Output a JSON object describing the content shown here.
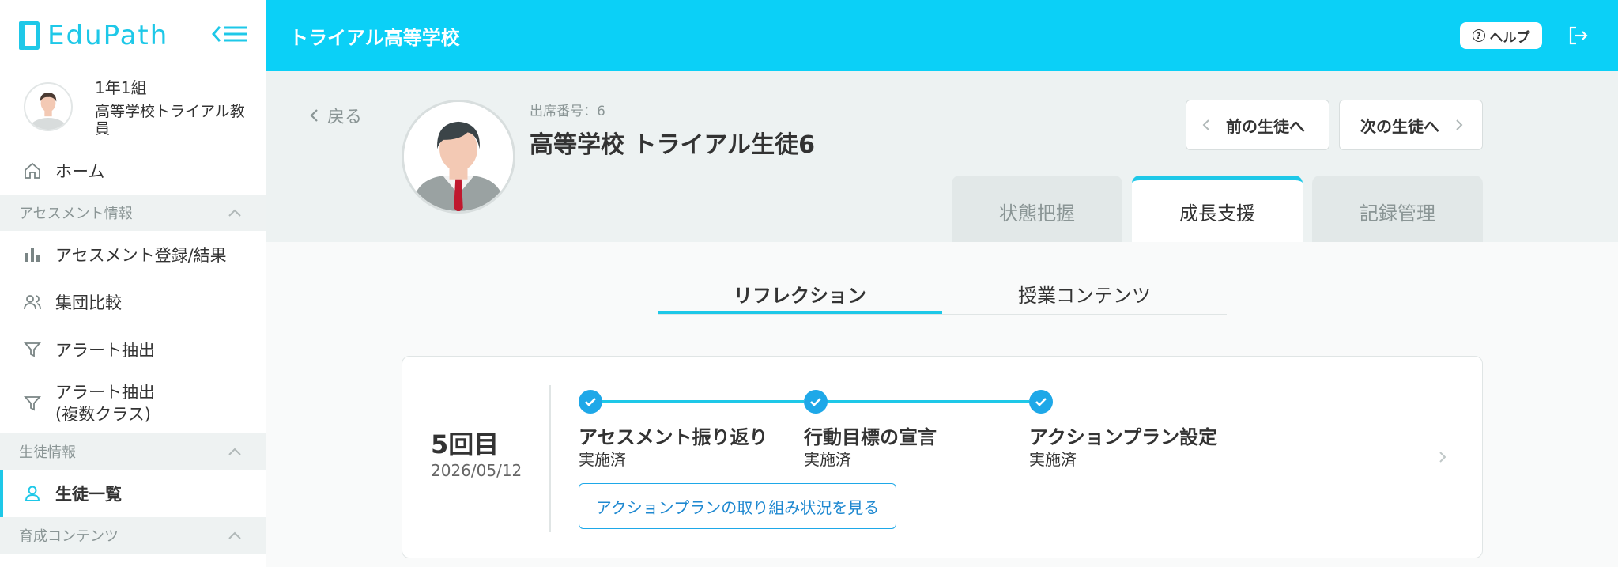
{
  "app": {
    "logo_text": "EduPath",
    "brand_color": "#1ec8e8",
    "header_color": "#0bd0f7"
  },
  "header": {
    "school_title": "トライアル高等学校",
    "help_label": "ヘルプ"
  },
  "user": {
    "class_name": "1年1組",
    "user_name": "高等学校トライアル教員"
  },
  "sidebar": {
    "home": "ホーム",
    "sections": [
      {
        "title": "アセスメント情報",
        "items": [
          "アセスメント登録/結果",
          "集団比較",
          "アラート抽出",
          "アラート抽出\n(複数クラス)"
        ]
      },
      {
        "title": "生徒情報",
        "items": [
          "生徒一覧"
        ]
      },
      {
        "title": "育成コンテンツ"
      }
    ]
  },
  "student": {
    "back_label": "戻る",
    "attendance_number": "出席番号：6",
    "name": "高等学校 トライアル生徒6",
    "prev_label": "前の生徒へ",
    "next_label": "次の生徒へ"
  },
  "tabs": [
    {
      "label": "状態把握",
      "active": false
    },
    {
      "label": "成長支援",
      "active": true
    },
    {
      "label": "記録管理",
      "active": false
    }
  ],
  "subtabs": [
    {
      "label": "リフレクション",
      "active": true
    },
    {
      "label": "授業コンテンツ",
      "active": false
    }
  ],
  "reflection_card": {
    "round": "5回目",
    "date": "2026/05/12",
    "steps": [
      {
        "title": "アセスメント振り返り",
        "status": "実施済"
      },
      {
        "title": "行動目標の宣言",
        "status": "実施済"
      },
      {
        "title": "アクションプラン設定",
        "status": "実施済"
      }
    ],
    "action_button": "アクションプランの取り組み状況を見る"
  }
}
